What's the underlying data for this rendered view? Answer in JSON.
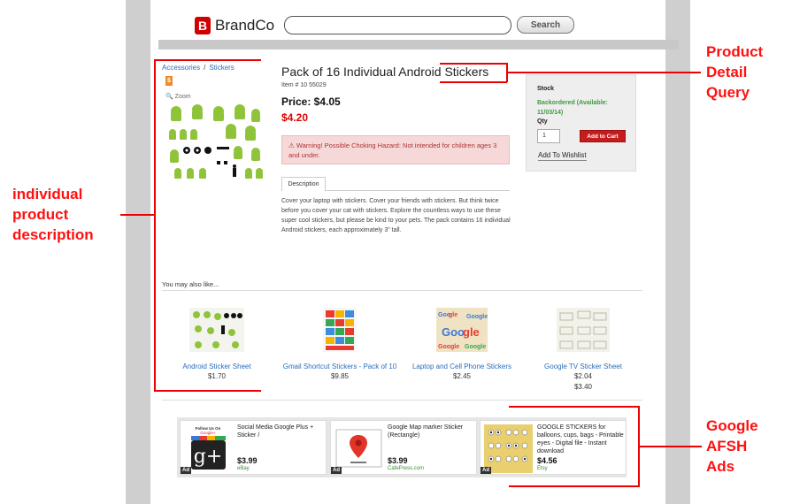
{
  "header": {
    "logo_mark": "B",
    "logo_text": "BrandCo",
    "search_value": "",
    "search_button": "Search"
  },
  "breadcrumb": {
    "category": "Accessories",
    "separator": "/",
    "subcategory": "Stickers"
  },
  "product": {
    "badge": "$",
    "zoom_label": "Zoom",
    "title": "Pack of 16 Individual Android Stickers",
    "item_number": "Item # 10 55029",
    "price": "Price: $4.05",
    "sale_price": "$4.20",
    "warning": "Warning! Possible Choking Hazard: Not intended for children ages 3 and under.",
    "tab_label": "Description",
    "description": "Cover your laptop with stickers. Cover your friends with stickers. But think twice before you cover your cat with stickers. Explore the countless ways to use these super cool stickers, but please be kind to your pets. The pack contains 16 individual Android stickers, each approximately 3\" tall."
  },
  "stock_box": {
    "stock_label": "Stock",
    "status": "Backordered (Available: 11/03/14)",
    "qty_label": "Qty",
    "qty_value": "1",
    "add_to_cart": "Add to Cart",
    "wishlist": "Add To Wishlist"
  },
  "recommendations": {
    "heading": "You may also like...",
    "items": [
      {
        "name": "Android Sticker Sheet",
        "price": "$1.70",
        "price2": ""
      },
      {
        "name": "Gmail Shortcut Stickers - Pack of 10",
        "price": "$9.85",
        "price2": ""
      },
      {
        "name": "Laptop and Cell Phone Stickers",
        "price": "$2.45",
        "price2": ""
      },
      {
        "name": "Google TV Sticker Sheet",
        "price": "$2.04",
        "price2": "$3.40"
      }
    ]
  },
  "ads": [
    {
      "title": "Social Media Google Plus + Sticker /",
      "price": "$3.99",
      "store": "eBay",
      "tag": "Ad",
      "img_text": "Follow Us On",
      "img_text2": "Google+"
    },
    {
      "title": "Google Map marker Sticker (Rectangle)",
      "price": "$3.99",
      "store": "CafePress.com",
      "tag": "Ad"
    },
    {
      "title": "GOOGLE STICKERS for balloons, cups, bags - Printable eyes - Digital file - Instant download",
      "price": "$4.56",
      "store": "Etsy",
      "tag": "Ad"
    }
  ],
  "annotations": {
    "product_detail": [
      "Product",
      "Detail",
      "Query"
    ],
    "individual": [
      "individual",
      "product",
      "description"
    ],
    "afsh": [
      "Google",
      "AFSH",
      "Ads"
    ]
  },
  "colors": {
    "brand_red": "#d10000",
    "annotation_red": "#ff1010",
    "link_blue": "#2a6ebb",
    "stock_green": "#3f9a3f"
  }
}
